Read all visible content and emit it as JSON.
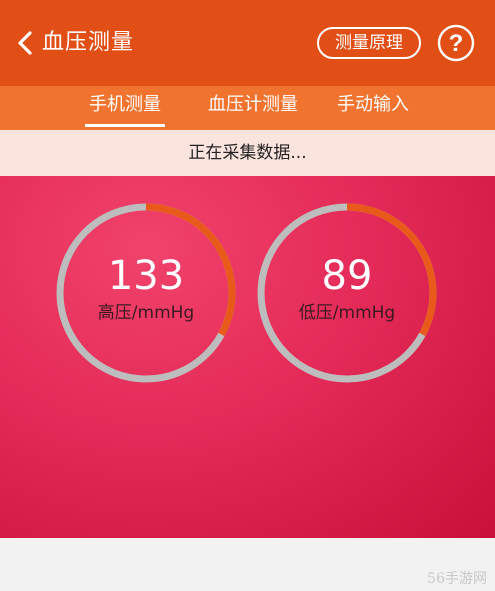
{
  "header": {
    "title": "血压测量",
    "principle_label": "测量原理",
    "help_glyph": "?"
  },
  "tabs": [
    {
      "label": "手机测量",
      "active": true
    },
    {
      "label": "血压计测量",
      "active": false
    },
    {
      "label": "手动输入",
      "active": false
    }
  ],
  "status": "正在采集数据...",
  "gauges": [
    {
      "value": "133",
      "unit": "高压/mmHg",
      "progress": 0.33
    },
    {
      "value": "89",
      "unit": "低压/mmHg",
      "progress": 0.33
    }
  ],
  "colors": {
    "header": "#e14f16",
    "tabs": "#f0742f",
    "ring_track": "#bdbdbd",
    "ring_progress": "#e8591a"
  },
  "watermark": "56手游网"
}
